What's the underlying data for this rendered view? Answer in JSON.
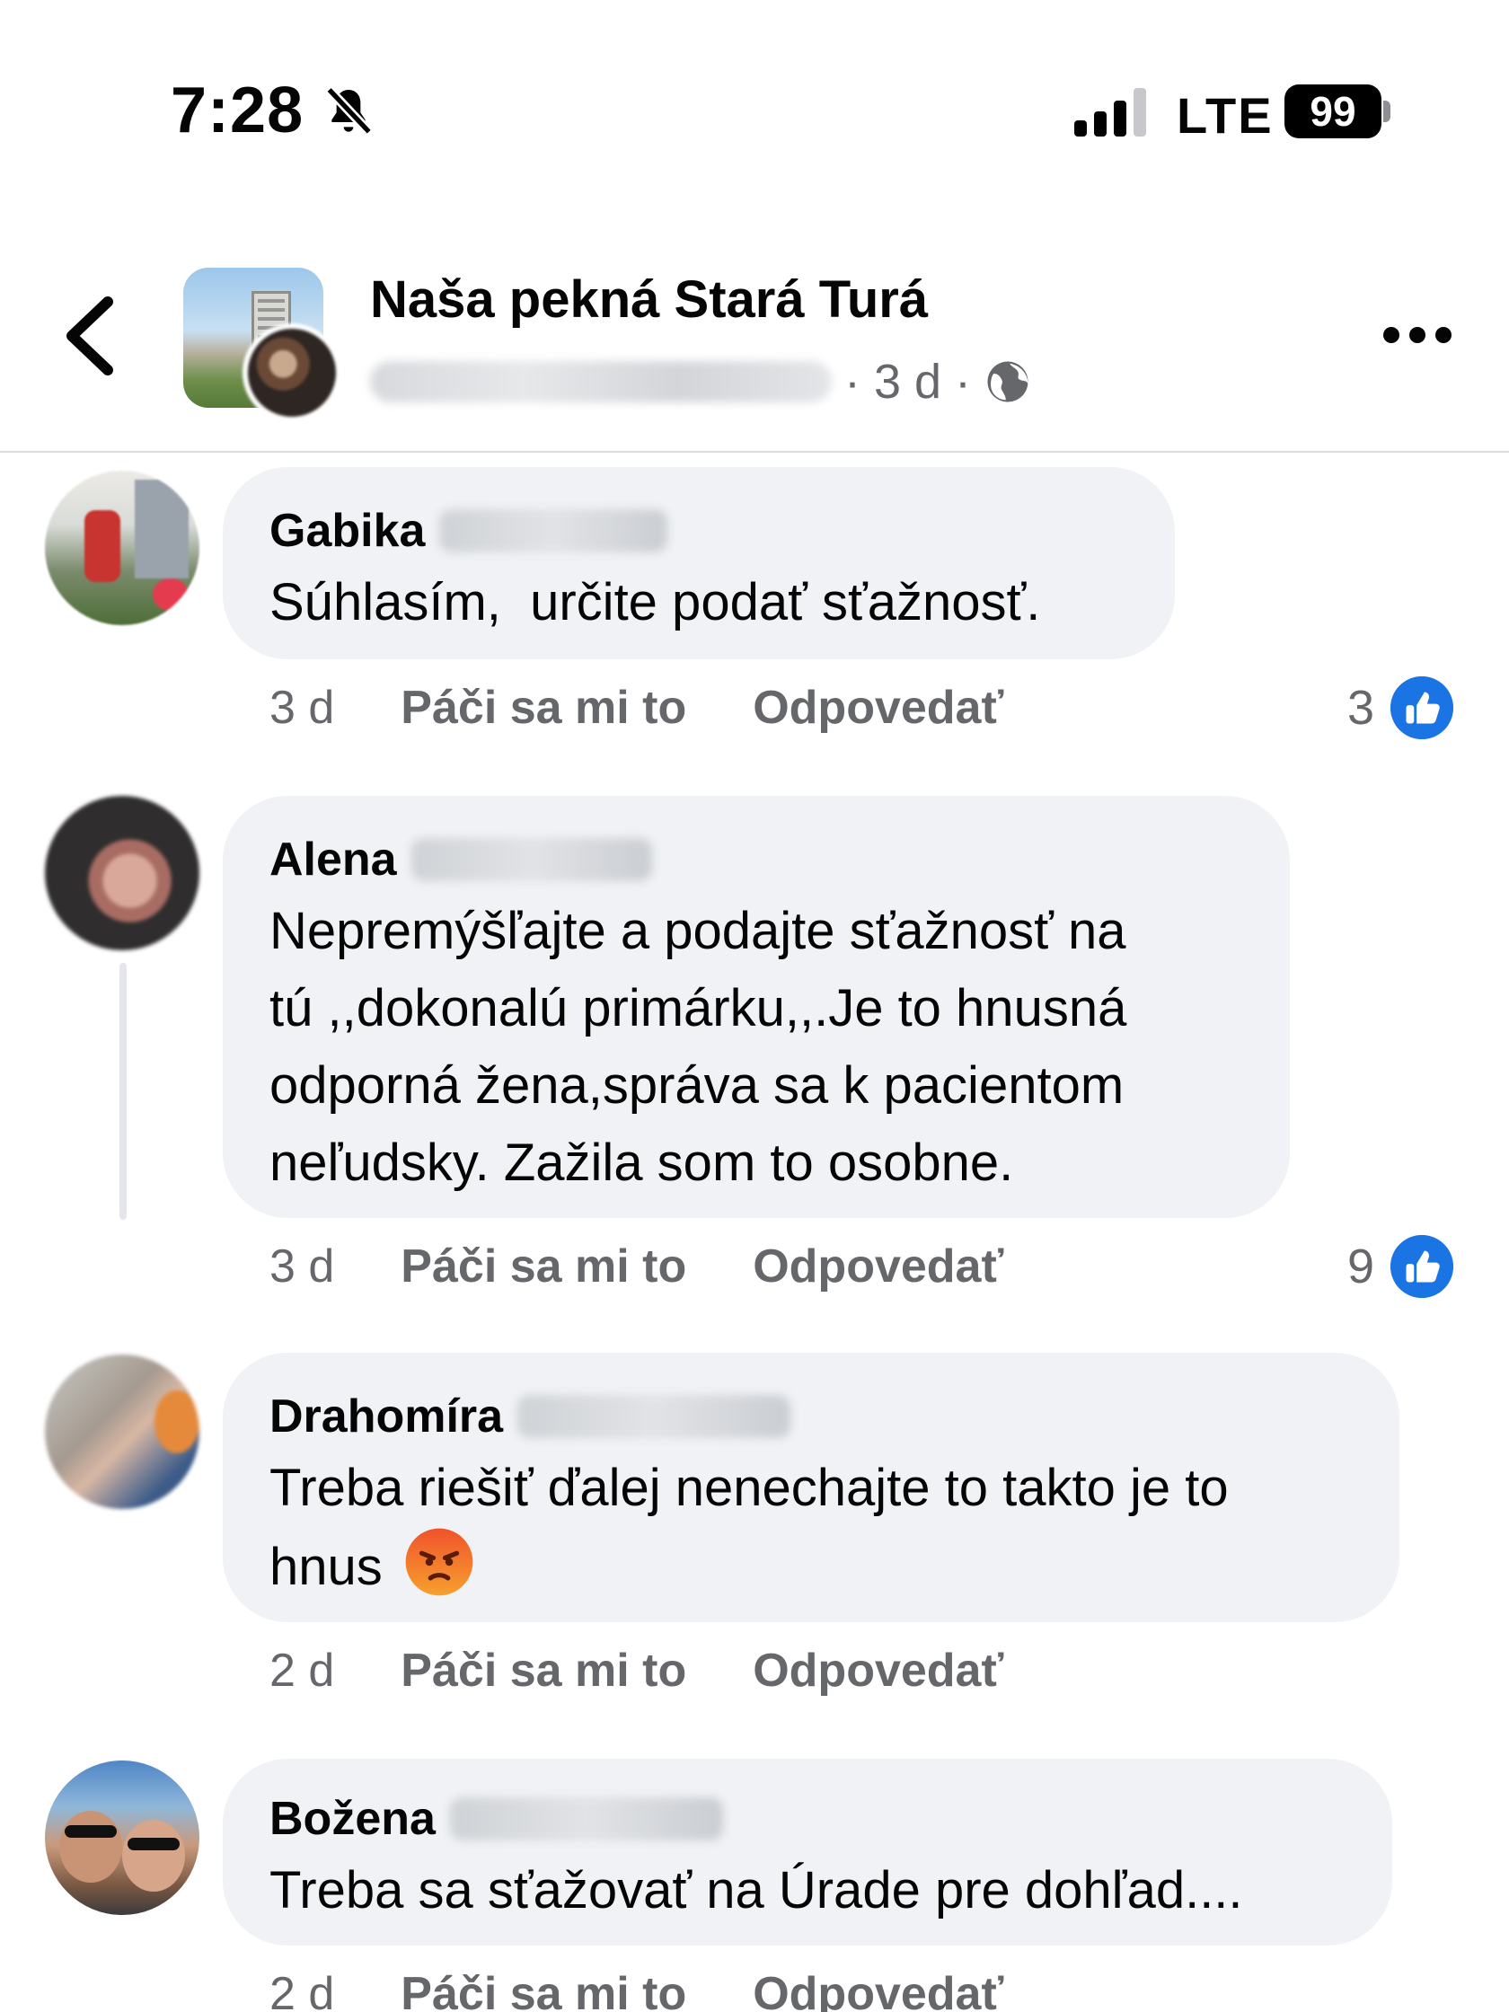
{
  "status_bar": {
    "time": "7:28",
    "network": "LTE",
    "battery": "99",
    "icons": [
      "bell-slash-icon",
      "cellular-signal-icon",
      "battery-icon"
    ]
  },
  "header": {
    "back_icon": "chevron-left-icon",
    "group_name": "Naša pekná Stará Turá",
    "meta": "· 3 d ·",
    "privacy_icon": "globe-icon",
    "more_icon": "more-horizontal-icon"
  },
  "colors": {
    "bubble": "#f0f2f5",
    "secondary_text": "#65676b",
    "like_blue": "#1b74e4",
    "divider": "#dadde1"
  },
  "comments": [
    {
      "name": "Gabika",
      "text": "Súhlasím,  určite podať sťažnosť.",
      "time": "3 d",
      "like_label": "Páči sa mi to",
      "reply_label": "Odpovedať",
      "reaction_count": "3",
      "reaction_icon": "like-thumb-icon"
    },
    {
      "name": "Alena",
      "text": "Nepremýšľajte a podajte sťažnosť na\ntú ,,dokonalú primárku,,.Je to hnusná\nodporná žena,správa sa k pacientom\nneľudsky. Zažila som to osobne.",
      "time": "3 d",
      "like_label": "Páči sa mi to",
      "reply_label": "Odpovedať",
      "reaction_count": "9",
      "reaction_icon": "like-thumb-icon"
    },
    {
      "name": "Drahomíra",
      "text": "Treba riešiť ďalej nenechajte to takto je to\nhnus",
      "emoji_icon": "angry-face-icon",
      "time": "2 d",
      "like_label": "Páči sa mi to",
      "reply_label": "Odpovedať"
    },
    {
      "name": "Božena",
      "text": "Treba sa sťažovať na Úrade pre dohľad....",
      "time": "2 d",
      "like_label": "Páči sa mi to",
      "reply_label": "Odpovedať"
    }
  ]
}
